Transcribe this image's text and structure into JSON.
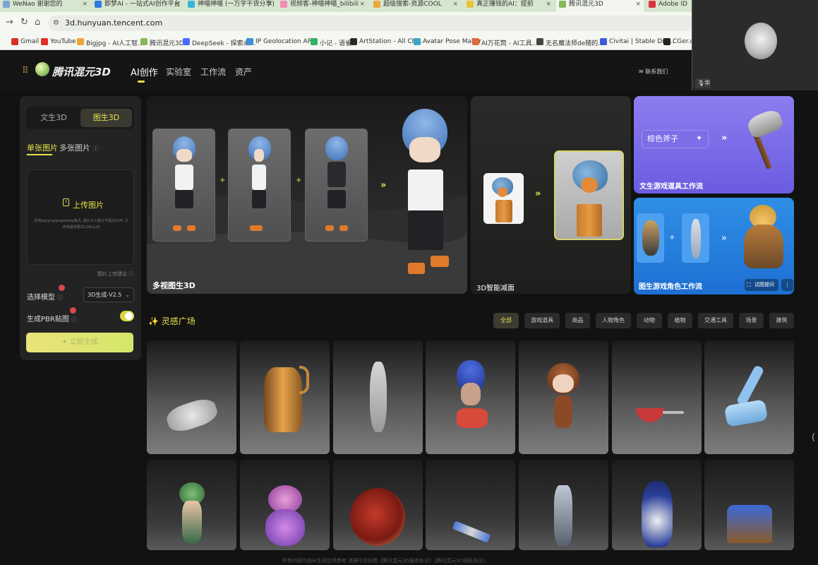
{
  "browser": {
    "tabs": [
      {
        "label": "WeNao 谢谢您的"
      },
      {
        "label": "即梦AI - 一站式AI创作平台"
      },
      {
        "label": "神喵神喵 (一万字干货分享)"
      },
      {
        "label": "视频客-神喵神喵_bilibili"
      },
      {
        "label": "超级搜索-资源COOL"
      },
      {
        "label": "真正赚钱的AI：提前"
      },
      {
        "label": "腾讯混元3D"
      },
      {
        "label": "Adobe ID"
      }
    ],
    "url": "3d.hunyuan.tencent.com",
    "bookmarks": [
      {
        "label": "Gmail",
        "color": "#d93025"
      },
      {
        "label": "YouTube",
        "color": "#e52d27"
      },
      {
        "label": "Bigjpg - AI人工智...",
        "color": "#f1a33a"
      },
      {
        "label": "腾讯混元3D",
        "color": "#86b85a"
      },
      {
        "label": "DeepSeek - 探索未...",
        "color": "#4d6bfe"
      },
      {
        "label": "IP Geolocation AP...",
        "color": "#3c8fd8"
      },
      {
        "label": "小记 - 语雀",
        "color": "#31b45d"
      },
      {
        "label": "ArtStation - All Ch...",
        "color": "#2a2a2a"
      },
      {
        "label": "Avatar Pose Maker",
        "color": "#38a9c8"
      },
      {
        "label": "AI万花筒 - AI工具...",
        "color": "#e06a3a"
      },
      {
        "label": "无名魔法师de随的...",
        "color": "#444444"
      },
      {
        "label": "Civitai | Stable Diff...",
        "color": "#3d5ad8"
      },
      {
        "label": "CGer.co",
        "color": "#222222"
      }
    ]
  },
  "app": {
    "brand": "腾讯混元3D",
    "nav": [
      {
        "label": "AI创作"
      },
      {
        "label": "实验室"
      },
      {
        "label": "工作流"
      },
      {
        "label": "资产"
      }
    ],
    "contact": "联系我们",
    "accent": "#e6e24a"
  },
  "webcam": {
    "name": "华"
  },
  "left_panel": {
    "mode_text": "文生3D",
    "mode_image": "图生3D",
    "tab_single": "单张图片",
    "tab_multi": "多张图片",
    "upload_label": "上传图片",
    "upload_hint": "支持jpg/png/jpeg/webp格式, 图片大小最大不超过10M, 分辨率最低要求128x128",
    "upload_advice": "图片上传建议",
    "model_label": "选择模型",
    "model_value": "3D生成-V2.5",
    "pbr_label": "生成PBR贴图",
    "pbr_on": true,
    "generate_label": "立即生成"
  },
  "banners": {
    "multi_view": "多视图生3D",
    "smart_reduce": "3D智能减面",
    "text_game_prop": "文生游戏道具工作流",
    "axe_prompt": "棕色斧子",
    "image_game_char": "图生游戏角色工作流",
    "try_button": "试图提问"
  },
  "gallery": {
    "title": "灵感广场",
    "filters": [
      {
        "label": "全部"
      },
      {
        "label": "游戏道具"
      },
      {
        "label": "商品"
      },
      {
        "label": "人物角色"
      },
      {
        "label": "动物"
      },
      {
        "label": "植物"
      },
      {
        "label": "交通工具"
      },
      {
        "label": "场景"
      },
      {
        "label": "建筑"
      }
    ]
  },
  "footer": "所有内容均由AI生成仅供参考 请遵守并知悉《腾讯混元3D服务协议》《腾讯混元3D隐私协议》"
}
